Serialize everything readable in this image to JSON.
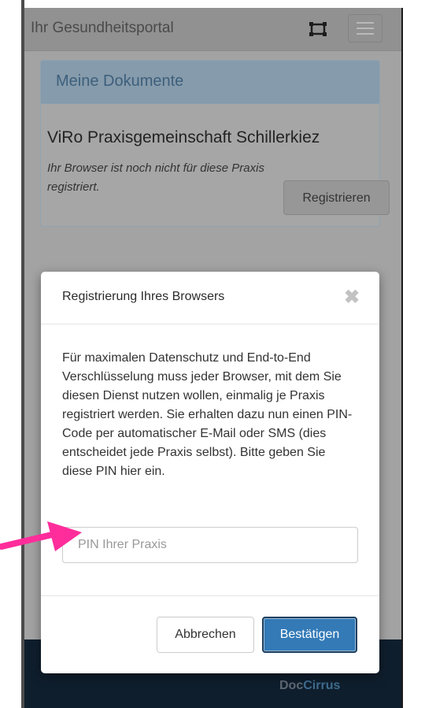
{
  "navbar": {
    "title": "Ihr Gesundheitsportal",
    "fullscreen_icon": "fullscreen-icon",
    "menu_icon": "hamburger-menu-icon"
  },
  "panel": {
    "title": "Meine Dokumente",
    "practice_name": "ViRo Praxisgemeinschaft Schillerkiez",
    "note": "Ihr Browser ist noch nicht für diese Praxis registriert.",
    "register_label": "Registrieren"
  },
  "modal": {
    "title": "Registrierung Ihres Browsers",
    "close_icon": "close-icon",
    "body": "Für maximalen Datenschutz und End-to-End Verschlüsselung muss jeder Browser, mit dem Sie diesen Dienst nutzen wollen, einmalig je Praxis registriert werden. Sie erhalten dazu nun einen PIN-Code per automatischer E-Mail oder SMS (dies entscheidet jede Praxis selbst). Bitte geben Sie diese PIN hier ein.",
    "pin_placeholder": "PIN Ihrer Praxis",
    "pin_value": "",
    "cancel_label": "Abbrechen",
    "confirm_label": "Bestätigen"
  },
  "footer": {
    "brand_part1": "Doc",
    "brand_part2": "Cirrus"
  },
  "colors": {
    "accent": "#337ab7",
    "arrow": "#ff2d9b",
    "overlay": "#a3a3a3",
    "footer": "#0f1e2d"
  }
}
